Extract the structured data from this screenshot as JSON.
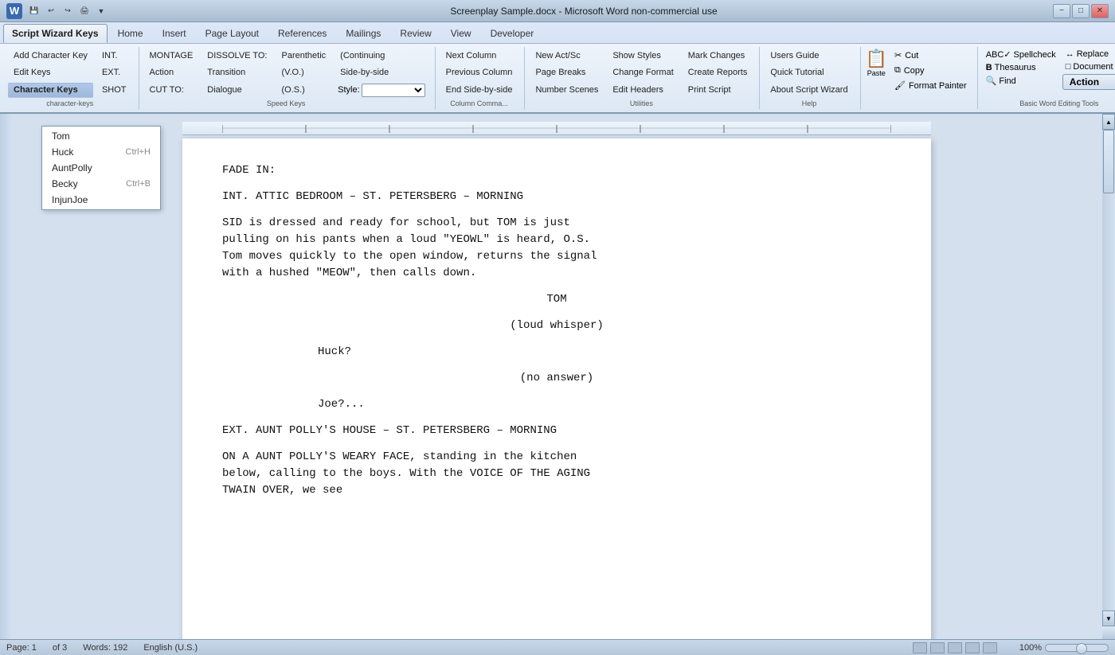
{
  "titleBar": {
    "icon": "W",
    "title": "Screenplay Sample.docx - Microsoft Word non-commercial use",
    "buttons": [
      "−",
      "□",
      "✕"
    ]
  },
  "qat": {
    "buttons": [
      "💾",
      "↩",
      "↪",
      "📋",
      "▼"
    ]
  },
  "tabs": [
    {
      "id": "script-wizard-keys",
      "label": "Script Wizard Keys",
      "active": true
    },
    {
      "id": "home",
      "label": "Home"
    },
    {
      "id": "insert",
      "label": "Insert"
    },
    {
      "id": "page-layout",
      "label": "Page Layout"
    },
    {
      "id": "references",
      "label": "References"
    },
    {
      "id": "mailings",
      "label": "Mailings"
    },
    {
      "id": "review",
      "label": "Review"
    },
    {
      "id": "view",
      "label": "View"
    },
    {
      "id": "developer",
      "label": "Developer"
    }
  ],
  "ribbon": {
    "groups": [
      {
        "id": "character-keys",
        "label": "Character Keys",
        "buttons": [
          {
            "id": "add-character-key",
            "label": "Add Character Key",
            "active": false
          },
          {
            "id": "edit-keys",
            "label": "Edit Keys",
            "active": false
          },
          {
            "id": "character-keys",
            "label": "Character Keys",
            "active": true
          }
        ],
        "subButtons": [
          {
            "label": "INT.",
            "sublabel": ""
          },
          {
            "label": "EXT.",
            "sublabel": ""
          },
          {
            "label": "SHOT",
            "sublabel": ""
          }
        ]
      },
      {
        "id": "transitions",
        "label": "Speed Keys",
        "buttons": [
          {
            "label": "MONTAGE"
          },
          {
            "label": "Action"
          },
          {
            "label": "CUT TO:"
          }
        ],
        "buttons2": [
          {
            "label": "DISSOLVE TO:"
          },
          {
            "label": "Transition"
          },
          {
            "label": "Dialogue"
          }
        ],
        "buttons3": [
          {
            "label": "Parenthetic"
          },
          {
            "label": "(V.O.)"
          },
          {
            "label": "(O.S.)"
          }
        ],
        "buttons4": [
          {
            "label": "(Continuing"
          },
          {
            "label": "Side-by-side"
          },
          {
            "label": "Style:",
            "hasSelect": true
          }
        ]
      },
      {
        "id": "column-commands",
        "label": "Column Comma...",
        "buttons": [
          {
            "label": "Next Column"
          },
          {
            "label": "Previous Column"
          },
          {
            "label": "End Side-by-side"
          }
        ]
      },
      {
        "id": "utilities",
        "label": "Utilities",
        "buttons": [
          {
            "label": "New Act/Sc"
          },
          {
            "label": "Page Breaks"
          },
          {
            "label": "Number Scenes"
          }
        ],
        "buttons2": [
          {
            "label": "Show Styles"
          },
          {
            "label": "Change Format"
          },
          {
            "label": "Edit Headers"
          }
        ],
        "buttons3": [
          {
            "label": "Mark Changes"
          },
          {
            "label": "Create Reports"
          },
          {
            "label": "Print Script"
          }
        ]
      },
      {
        "id": "help",
        "label": "Help",
        "buttons": [
          {
            "label": "Users Guide"
          },
          {
            "label": "Quick Tutorial"
          },
          {
            "label": "About Script Wizard"
          }
        ]
      },
      {
        "id": "clipboard",
        "label": "",
        "paste": "Paste",
        "cut": "Cut",
        "copy": "Copy",
        "formatPainter": "Format Painter"
      },
      {
        "id": "word-tools",
        "label": "Basic Word Editing Tools",
        "spellcheck": "Spellcheck",
        "thesaurus": "Thesaurus",
        "find": "Find",
        "replace": "Replace",
        "docMap": "Document Map",
        "action": "Action"
      }
    ]
  },
  "dropdown": {
    "items": [
      {
        "label": "Tom",
        "shortcut": ""
      },
      {
        "label": "Huck",
        "shortcut": "Ctrl+H"
      },
      {
        "label": "AuntPolly",
        "shortcut": ""
      },
      {
        "label": "Becky",
        "shortcut": "Ctrl+B"
      },
      {
        "label": "InjunJoe",
        "shortcut": ""
      }
    ]
  },
  "document": {
    "paragraphs": [
      {
        "type": "action",
        "text": "FADE IN:"
      },
      {
        "type": "action",
        "text": ""
      },
      {
        "type": "scene",
        "text": "INT. ATTIC BEDROOM – ST. PETERSBERG – MORNING"
      },
      {
        "type": "action",
        "text": ""
      },
      {
        "type": "action",
        "text": "SID is dressed and ready for school, but TOM is just\npulling on his pants when a loud \"YEOWL\" is heard, O.S.\nTom moves quickly to the open window, returns the signal\nwith a hushed \"MEOW\", then calls down."
      },
      {
        "type": "action",
        "text": ""
      },
      {
        "type": "character",
        "text": "TOM"
      },
      {
        "type": "parenthetical",
        "text": "(loud whisper)"
      },
      {
        "type": "dialogue",
        "text": "Huck?"
      },
      {
        "type": "parenthetical",
        "text": "(no answer)"
      },
      {
        "type": "dialogue",
        "text": "Joe?..."
      },
      {
        "type": "action",
        "text": ""
      },
      {
        "type": "scene",
        "text": "EXT.  AUNT POLLY'S HOUSE – ST. PETERSBERG – MORNING"
      },
      {
        "type": "action",
        "text": ""
      },
      {
        "type": "action",
        "text": "ON A AUNT POLLY'S WEARY FACE, standing in the kitchen\nbelow, calling to the boys. With the VOICE OF THE AGING\nTWAIN OVER, we see"
      }
    ]
  },
  "statusBar": {
    "page": "Page: 1",
    "of": "of 3",
    "words": "Words: 192",
    "lang": "English (U.S.)"
  }
}
